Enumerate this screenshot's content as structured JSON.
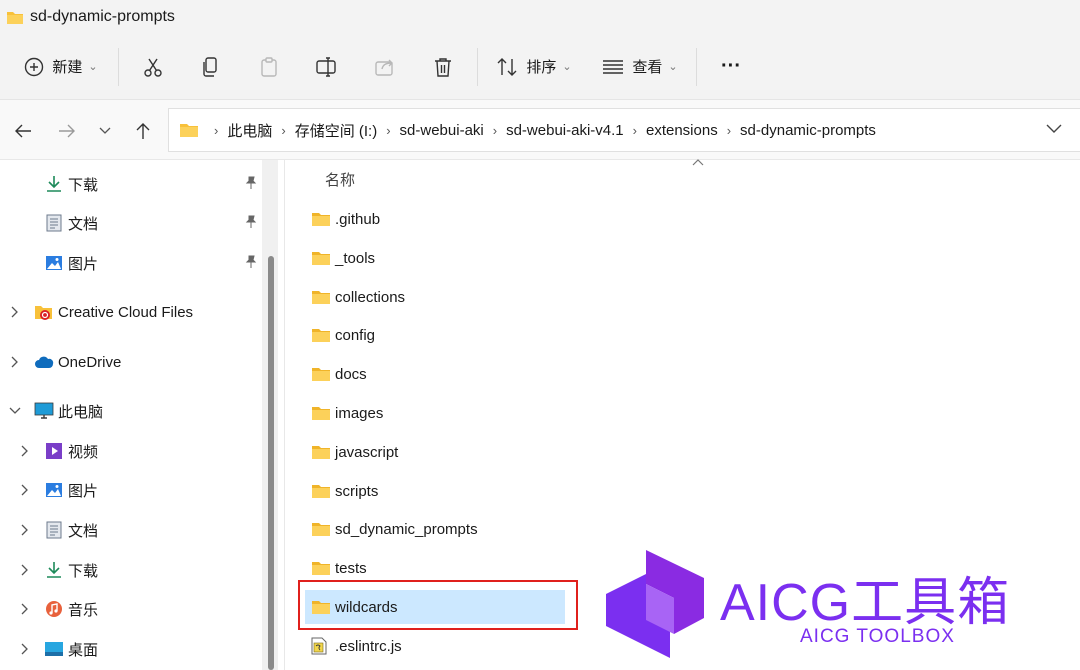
{
  "window": {
    "title": "sd-dynamic-prompts"
  },
  "toolbar": {
    "new_label": "新建",
    "sort_label": "排序",
    "view_label": "查看",
    "more_label": "···"
  },
  "address": {
    "crumbs": [
      "此电脑",
      "存储空间 (I:)",
      "sd-webui-aki",
      "sd-webui-aki-v4.1",
      "extensions",
      "sd-dynamic-prompts"
    ]
  },
  "sidebar": {
    "quick": [
      {
        "label": "下载",
        "icon": "download-icon"
      },
      {
        "label": "文档",
        "icon": "document-icon"
      },
      {
        "label": "图片",
        "icon": "picture-icon"
      }
    ],
    "creative_cloud": "Creative Cloud Files",
    "onedrive": "OneDrive",
    "this_pc": "此电脑",
    "pc_items": [
      {
        "label": "视频",
        "icon": "video-icon"
      },
      {
        "label": "图片",
        "icon": "picture-icon"
      },
      {
        "label": "文档",
        "icon": "document-icon"
      },
      {
        "label": "下载",
        "icon": "download-icon"
      },
      {
        "label": "音乐",
        "icon": "music-icon"
      },
      {
        "label": "桌面",
        "icon": "desktop-icon"
      }
    ]
  },
  "list": {
    "column_name": "名称",
    "files": [
      {
        "name": ".github",
        "type": "folder"
      },
      {
        "name": "_tools",
        "type": "folder"
      },
      {
        "name": "collections",
        "type": "folder"
      },
      {
        "name": "config",
        "type": "folder"
      },
      {
        "name": "docs",
        "type": "folder"
      },
      {
        "name": "images",
        "type": "folder"
      },
      {
        "name": "javascript",
        "type": "folder"
      },
      {
        "name": "scripts",
        "type": "folder"
      },
      {
        "name": "sd_dynamic_prompts",
        "type": "folder"
      },
      {
        "name": "tests",
        "type": "folder"
      },
      {
        "name": "wildcards",
        "type": "folder",
        "selected": true
      },
      {
        "name": ".eslintrc.js",
        "type": "js"
      }
    ]
  },
  "watermark": {
    "title": "AICG工具箱",
    "subtitle": "AICG TOOLBOX"
  },
  "colors": {
    "accent": "#7b2ff0",
    "selection": "#cce8ff",
    "highlight": "#e0201c",
    "folder": "#f8c13a"
  }
}
